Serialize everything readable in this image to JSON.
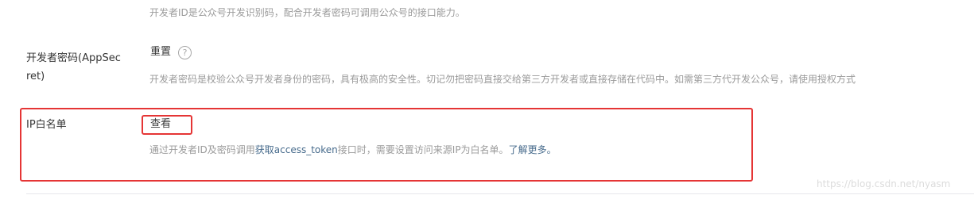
{
  "appid_section": {
    "description": "开发者ID是公众号开发识别码，配合开发者密码可调用公众号的接口能力。"
  },
  "appsecret_section": {
    "label_line1": "开发者密码(AppSec",
    "label_line2": "ret)",
    "reset_label": "重置",
    "help_icon_glyph": "?",
    "description": "开发者密码是校验公众号开发者身份的密码，具有极高的安全性。切记勿把密码直接交给第三方开发者或直接存储在代码中。如需第三方代开发公众号，请使用授权方式"
  },
  "ip_whitelist_section": {
    "label": "IP白名单",
    "view_label": "查看",
    "description_prefix": "通过开发者ID及密码调用",
    "description_link": "获取access_token",
    "description_suffix": "接口时，需要设置访问来源IP为白名单。",
    "learn_more": "了解更多。"
  },
  "watermark": "https://blog.csdn.net/nyasm",
  "colors": {
    "highlight_box": "#e53535",
    "link": "#476b8c"
  }
}
